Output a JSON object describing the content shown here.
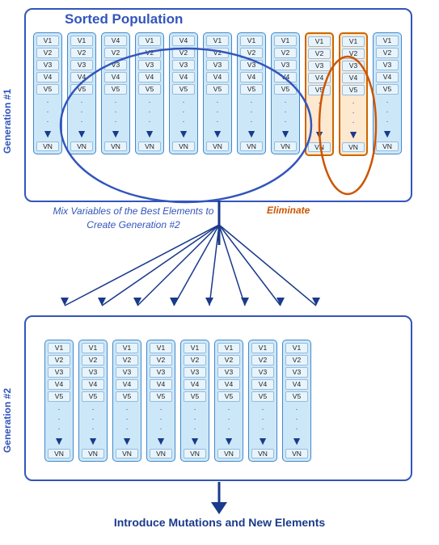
{
  "title": "Sorted Population",
  "gen1_label": "Generation #1",
  "gen2_label": "Generation #2",
  "mix_text": "Mix Variables of the Best Elements to Create Generation #2",
  "eliminate_text": "Eliminate",
  "mutations_text": "Introduce Mutations and New Elements",
  "columns_gen1": [
    {
      "vars": [
        "V1",
        "V2",
        "V3",
        "V4",
        "V5"
      ],
      "vn": "VN",
      "highlight": false
    },
    {
      "vars": [
        "V1",
        "V2",
        "V3",
        "V4",
        "V5"
      ],
      "vn": "VN",
      "highlight": false
    },
    {
      "vars": [
        "V4",
        "V2",
        "V3",
        "V4",
        "V5"
      ],
      "vn": "VN",
      "highlight": false
    },
    {
      "vars": [
        "V1",
        "V2",
        "V3",
        "V4",
        "V5"
      ],
      "vn": "VN",
      "highlight": false
    },
    {
      "vars": [
        "V4",
        "V2",
        "V3",
        "V4",
        "V5"
      ],
      "vn": "VN",
      "highlight": false
    },
    {
      "vars": [
        "V1",
        "V2",
        "V3",
        "V4",
        "V5"
      ],
      "vn": "VN",
      "highlight": false
    },
    {
      "vars": [
        "V1",
        "V2",
        "V3",
        "V4",
        "V5"
      ],
      "vn": "VN",
      "highlight": false
    },
    {
      "vars": [
        "V1",
        "V2",
        "V3",
        "V4",
        "V5"
      ],
      "vn": "VN",
      "highlight": false
    },
    {
      "vars": [
        "V1",
        "V2",
        "V3",
        "V4",
        "V5"
      ],
      "vn": "VN",
      "highlight": true
    },
    {
      "vars": [
        "V1",
        "V2",
        "V3",
        "V4",
        "V5"
      ],
      "vn": "VN",
      "highlight": true
    },
    {
      "vars": [
        "V1",
        "V2",
        "V3",
        "V4",
        "V5"
      ],
      "vn": "VN",
      "highlight": false
    }
  ],
  "columns_gen2": [
    {
      "vars": [
        "V1",
        "V2",
        "V3",
        "V4",
        "V5"
      ],
      "vn": "VN"
    },
    {
      "vars": [
        "V1",
        "V2",
        "V3",
        "V4",
        "V5"
      ],
      "vn": "VN"
    },
    {
      "vars": [
        "V1",
        "V2",
        "V3",
        "V4",
        "V5"
      ],
      "vn": "VN"
    },
    {
      "vars": [
        "V1",
        "V2",
        "V3",
        "V4",
        "V5"
      ],
      "vn": "VN"
    },
    {
      "vars": [
        "V1",
        "V2",
        "V3",
        "V4",
        "V5"
      ],
      "vn": "VN"
    },
    {
      "vars": [
        "V1",
        "V2",
        "V3",
        "V4",
        "V5"
      ],
      "vn": "VN"
    },
    {
      "vars": [
        "V1",
        "V2",
        "V3",
        "V4",
        "V5"
      ],
      "vn": "VN"
    },
    {
      "vars": [
        "V1",
        "V2",
        "V3",
        "V4",
        "V5"
      ],
      "vn": "VN"
    }
  ],
  "colors": {
    "blue_dark": "#1a3a8a",
    "blue_med": "#3355bb",
    "blue_light": "#cce8f8",
    "orange": "#cc5500"
  }
}
